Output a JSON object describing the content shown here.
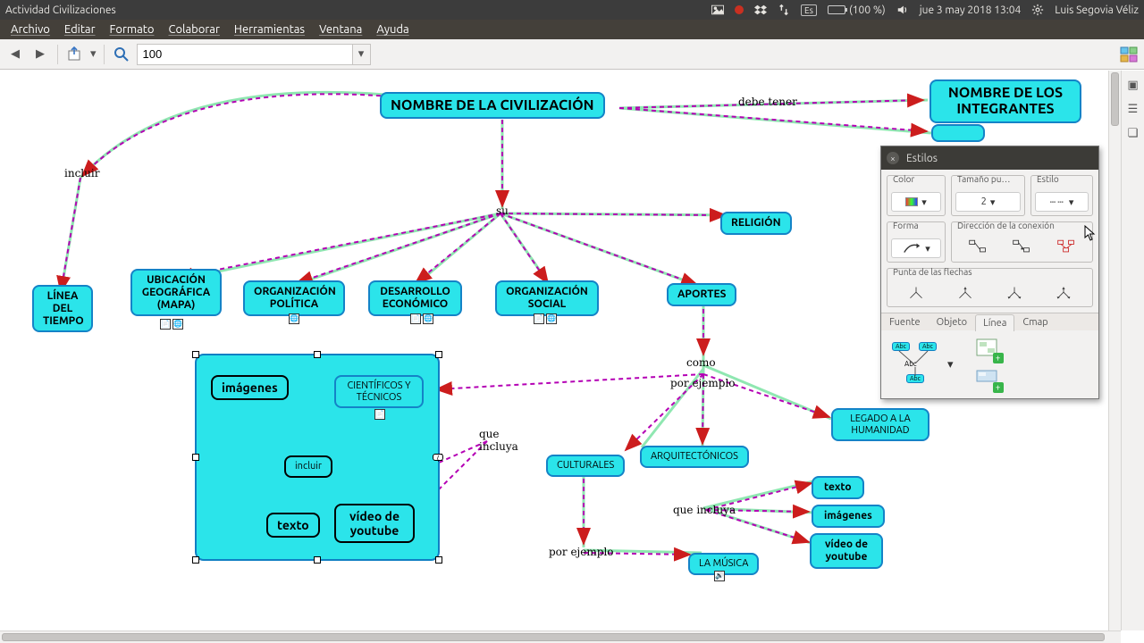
{
  "panel": {
    "window_title": "Actividad Civilizaciones",
    "lang": "Es",
    "battery": "(100 %)",
    "datetime": "jue  3 may 2018 13:04",
    "user": "Luis Segovia Véliz"
  },
  "menubar": [
    "Archivo",
    "Editar",
    "Formato",
    "Colaborar",
    "Herramientas",
    "Ventana",
    "Ayuda"
  ],
  "toolbar": {
    "zoom": "100"
  },
  "nodes": {
    "main": "NOMBRE DE LA CIVILIZACIÓN",
    "members": "NOMBRE DE LOS INTEGRANTES",
    "religion": "RELIGIÓN",
    "timeline": "LÍNEA DEL TIEMPO",
    "geo": "UBICACIÓN GEOGRÁFICA (MAPA)",
    "political": "ORGANIZACIÓN POLÍTICA",
    "econ": "DESARROLLO ECONÓMICO",
    "social": "ORGANIZACIÓN SOCIAL",
    "aportes": "APORTES",
    "scitech": "CIENTÍFICOS Y TÉCNICOS",
    "cultural": "CULTURALES",
    "arch": "ARQUITECTÓNICOS",
    "legacy": "LEGADO A LA HUMANIDAD",
    "music": "LA MÚSICA",
    "images": "imágenes",
    "texto": "texto",
    "youtube": "vídeo de youtube",
    "incluir": "incluir",
    "texto2": "texto",
    "images2": "imágenes",
    "youtube2": "vídeo de youtube"
  },
  "labels": {
    "debe_tener": "debe tener",
    "incluir": "incluir",
    "su": "su",
    "como": "como",
    "por_ejemplo": "por ejemplo",
    "que_incluya": "que incluya",
    "que_incluya2": "que incluya",
    "por_ejemplo2": "por ejemplo"
  },
  "dialog": {
    "title": "Estilos",
    "groups": {
      "color": "Color",
      "size": "Tamaño pu…",
      "size_val": "2",
      "style": "Estilo",
      "shape": "Forma",
      "dir": "Dirección de la conexión",
      "arrow": "Punta de las flechas"
    },
    "tabs": [
      "Fuente",
      "Objeto",
      "Línea",
      "Cmap"
    ],
    "active_tab": 2,
    "abc": "Abc"
  }
}
